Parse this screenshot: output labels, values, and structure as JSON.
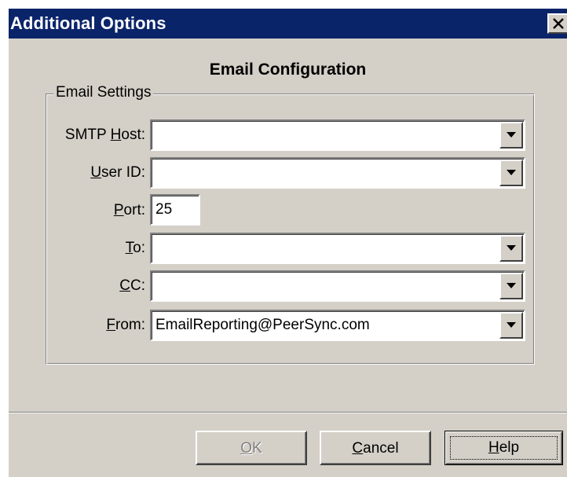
{
  "window": {
    "title": "Additional Options",
    "close_icon": "close-x-icon"
  },
  "heading": "Email Configuration",
  "group": {
    "legend": "Email Settings"
  },
  "fields": {
    "smtp_host": {
      "label_pre": "SMTP ",
      "label_key": "H",
      "label_post": "ost:",
      "value": ""
    },
    "user_id": {
      "label_pre": "",
      "label_key": "U",
      "label_post": "ser ID:",
      "value": ""
    },
    "port": {
      "label_pre": "",
      "label_key": "P",
      "label_post": "ort:",
      "value": "25"
    },
    "to": {
      "label_pre": "",
      "label_key": "T",
      "label_post": "o:",
      "value": ""
    },
    "cc": {
      "label_pre": "",
      "label_key": "C",
      "label_post": "C:",
      "value": ""
    },
    "from": {
      "label_pre": "",
      "label_key": "F",
      "label_post": "rom:",
      "value": "EmailReporting@PeerSync.com"
    }
  },
  "buttons": {
    "ok": {
      "key": "O",
      "rest": "K",
      "enabled": false
    },
    "cancel": {
      "key": "C",
      "rest": "ancel"
    },
    "help": {
      "key": "H",
      "rest": "elp"
    }
  },
  "colors": {
    "titlebar": "#0a246a",
    "face": "#d4d0c8"
  }
}
